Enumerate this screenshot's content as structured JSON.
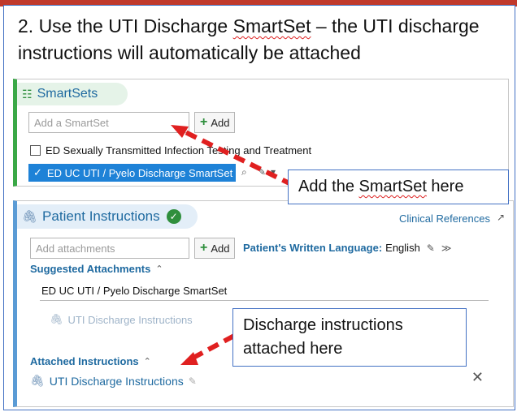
{
  "heading": {
    "prefix": "2. Use the UTI Discharge ",
    "underlined": "SmartSet",
    "suffix": " – the UTI discharge instructions will automatically be attached"
  },
  "smartsets": {
    "title": "SmartSets",
    "input_placeholder": "Add a SmartSet",
    "add_label": "Add",
    "option_unchecked": "ED Sexually Transmitted Infection Testing and Treatment",
    "option_selected": "ED UC UTI / Pyelo Discharge SmartSet"
  },
  "patient_instructions": {
    "title": "Patient Instructions",
    "clinical_references": "Clinical References",
    "attach_placeholder": "Add attachments",
    "add_label": "Add",
    "language_label": "Patient's Written Language:",
    "language_value": "English",
    "suggested_title": "Suggested Attachments",
    "suggested_group": "ED UC UTI / Pyelo Discharge SmartSet",
    "suggested_item": "UTI Discharge Instructions",
    "attached_title": "Attached Instructions",
    "attached_item": "UTI Discharge Instructions"
  },
  "callouts": {
    "add_smartset_prefix": "Add the ",
    "add_smartset_underlined": "SmartSet",
    "add_smartset_suffix": " here",
    "discharge_line1": "Discharge instructions",
    "discharge_line2": "attached here"
  },
  "colors": {
    "accent_red": "#c0392b",
    "selected_blue": "#1e82d7",
    "smartset_green": "#3aa846",
    "link_blue": "#1f6aa0",
    "arrow_red": "#e02020"
  },
  "icons": [
    "smartset-list-icon",
    "plus-icon",
    "checkmark-icon",
    "paperclip-icon",
    "ok-circle-icon",
    "external-link-icon",
    "pencil-icon",
    "chevron-icon",
    "close-icon"
  ]
}
